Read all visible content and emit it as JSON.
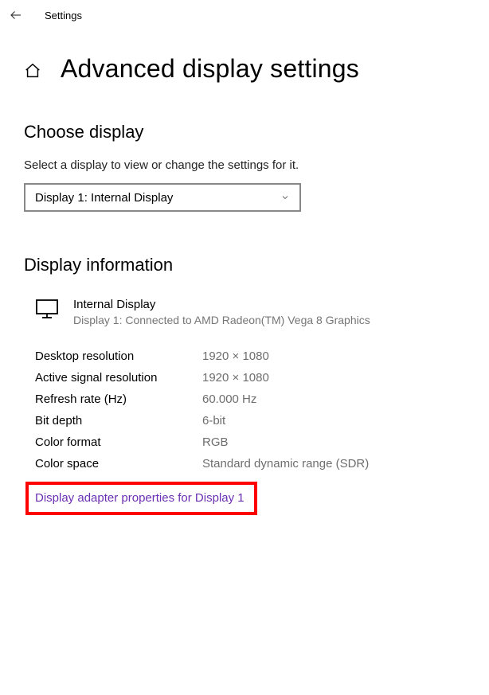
{
  "titlebar": {
    "title": "Settings"
  },
  "page": {
    "title": "Advanced display settings"
  },
  "choose_display": {
    "heading": "Choose display",
    "description": "Select a display to view or change the settings for it.",
    "dropdown_value": "Display 1: Internal Display"
  },
  "display_info": {
    "heading": "Display information",
    "name": "Internal Display",
    "sub": "Display 1: Connected to AMD Radeon(TM) Vega 8 Graphics",
    "rows": [
      {
        "label": "Desktop resolution",
        "value": "1920 × 1080"
      },
      {
        "label": "Active signal resolution",
        "value": "1920 × 1080"
      },
      {
        "label": "Refresh rate (Hz)",
        "value": "60.000 Hz"
      },
      {
        "label": "Bit depth",
        "value": "6-bit"
      },
      {
        "label": "Color format",
        "value": "RGB"
      },
      {
        "label": "Color space",
        "value": "Standard dynamic range (SDR)"
      }
    ],
    "adapter_link": "Display adapter properties for Display 1"
  }
}
